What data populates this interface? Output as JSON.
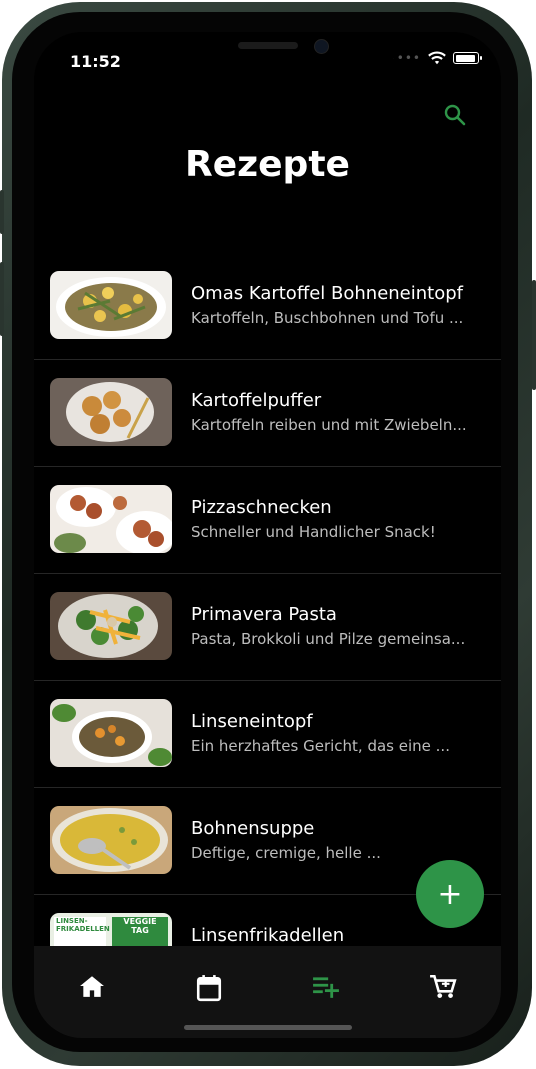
{
  "status_bar": {
    "time": "11:52"
  },
  "header": {
    "title": "Rezepte",
    "search_icon": "search-icon"
  },
  "colors": {
    "accent": "#2e9448",
    "background": "#000000",
    "nav_bg": "#121212",
    "subtitle": "#bdbdbd"
  },
  "recipes": [
    {
      "title": "Omas Kartoffel Bohneneintopf",
      "subtitle": "Kartoffeln, Buschbohnen und Tofu ..."
    },
    {
      "title": "Kartoffelpuffer",
      "subtitle": "Kartoffeln reiben und mit Zwiebeln..."
    },
    {
      "title": "Pizzaschnecken",
      "subtitle": "Schneller und Handlicher Snack!"
    },
    {
      "title": "Primavera Pasta",
      "subtitle": "Pasta, Brokkoli und Pilze gemeinsa..."
    },
    {
      "title": "Linseneintopf",
      "subtitle": "Ein herzhaftes Gericht, das eine ..."
    },
    {
      "title": "Bohnensuppe",
      "subtitle": "Deftige, cremige, helle ..."
    },
    {
      "title": "Linsenfrikadellen",
      "subtitle": ""
    }
  ],
  "thumbnail_labels": {
    "linsen": "LINSEN-FRIKADELLEN",
    "veggie": "VEGGIE TAG"
  },
  "fab": {
    "label": "+"
  },
  "bottom_nav": {
    "items": [
      {
        "icon": "home-icon",
        "active": false
      },
      {
        "icon": "calendar-icon",
        "active": false
      },
      {
        "icon": "playlist-add-icon",
        "active": true
      },
      {
        "icon": "cart-icon",
        "active": false
      }
    ]
  }
}
